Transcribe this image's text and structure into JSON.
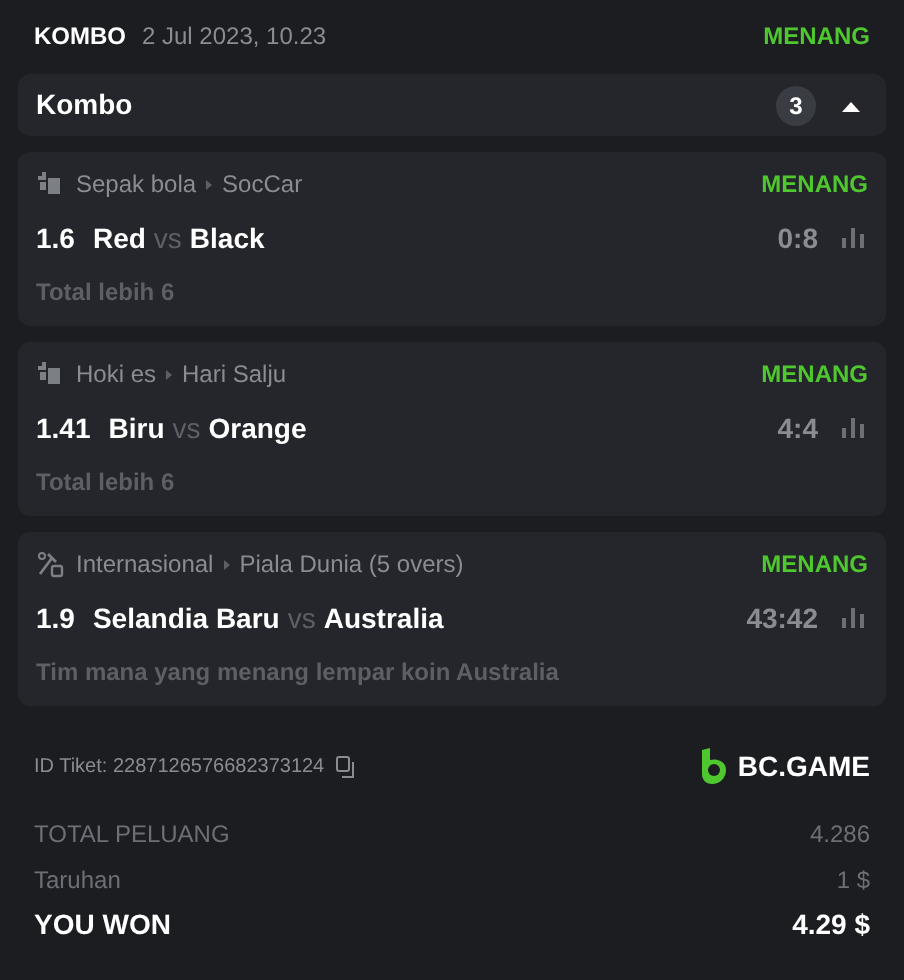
{
  "header": {
    "type": "KOMBO",
    "date": "2 Jul 2023, 10.23",
    "status": "MENANG"
  },
  "combo_bar": {
    "label": "Kombo",
    "count": "3",
    "expanded": true
  },
  "bets": [
    {
      "kind": "virtual",
      "league": "Sepak bola",
      "sub_league": "SocCar",
      "status": "MENANG",
      "odds": "1.6",
      "home": "Red",
      "vs": "vs",
      "away": "Black",
      "score": "0:8",
      "market": "Total lebih 6"
    },
    {
      "kind": "virtual",
      "league": "Hoki es",
      "sub_league": "Hari Salju",
      "status": "MENANG",
      "odds": "1.41",
      "home": "Biru",
      "vs": "vs",
      "away": "Orange",
      "score": "4:4",
      "market": "Total lebih 6"
    },
    {
      "kind": "cricket",
      "league": "Internasional",
      "sub_league": "Piala Dunia (5 overs)",
      "status": "MENANG",
      "odds": "1.9",
      "home": "Selandia Baru",
      "vs": "vs",
      "away": "Australia",
      "score": "43:42",
      "market": "Tim mana yang menang lempar koin Australia"
    }
  ],
  "ticket": {
    "label": "ID Tiket: 2287126576682373124",
    "brand": "BC.GAME"
  },
  "summary": [
    {
      "kind": "muted",
      "label": "TOTAL PELUANG",
      "value": "4.286"
    },
    {
      "kind": "muted",
      "label": "Taruhan",
      "value": "1 $"
    },
    {
      "kind": "strong",
      "label": "YOU WON",
      "value": "4.29 $"
    }
  ]
}
